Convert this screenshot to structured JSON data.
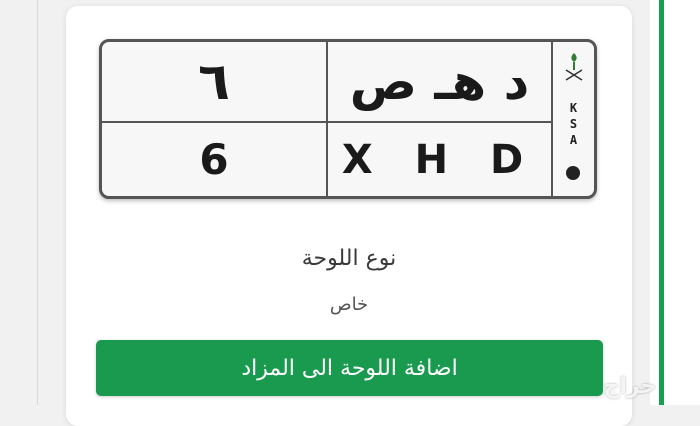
{
  "colors": {
    "accent_green": "#12a04b",
    "button_green": "#1a9a4f",
    "plate_border": "#555555",
    "background": "#f1f1f1"
  },
  "plate": {
    "arabic_number": "٦",
    "arabic_letters": "د هـ ص",
    "english_number": "6",
    "english_letters": "X H D",
    "country_code_letters": [
      "K",
      "S",
      "A"
    ],
    "emblem_icon": "saudi-emblem-icon"
  },
  "details": {
    "type_label": "نوع اللوحة",
    "type_value": "خاص"
  },
  "actions": {
    "add_to_auction_label": "اضافة اللوحة الى المزاد"
  },
  "watermark": {
    "text": "حراج"
  }
}
